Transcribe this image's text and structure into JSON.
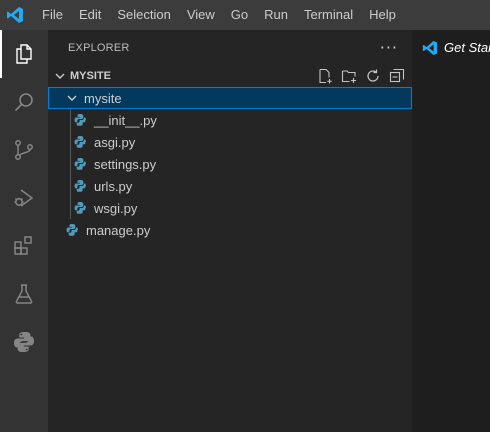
{
  "menu": [
    "File",
    "Edit",
    "Selection",
    "View",
    "Go",
    "Run",
    "Terminal",
    "Help"
  ],
  "explorer": {
    "title": "EXPLORER",
    "more": "···",
    "section_title": "MYSITE"
  },
  "tree": {
    "folder": "mysite",
    "files": [
      "__init__.py",
      "asgi.py",
      "settings.py",
      "urls.py",
      "wsgi.py"
    ],
    "root_file": "manage.py"
  },
  "editor": {
    "tab_label": "Get Started"
  },
  "colors": {
    "accent": "#007fd4",
    "selection": "#04395e",
    "vscode_blue": "#23a9f2",
    "python_blue": "#519aba"
  }
}
